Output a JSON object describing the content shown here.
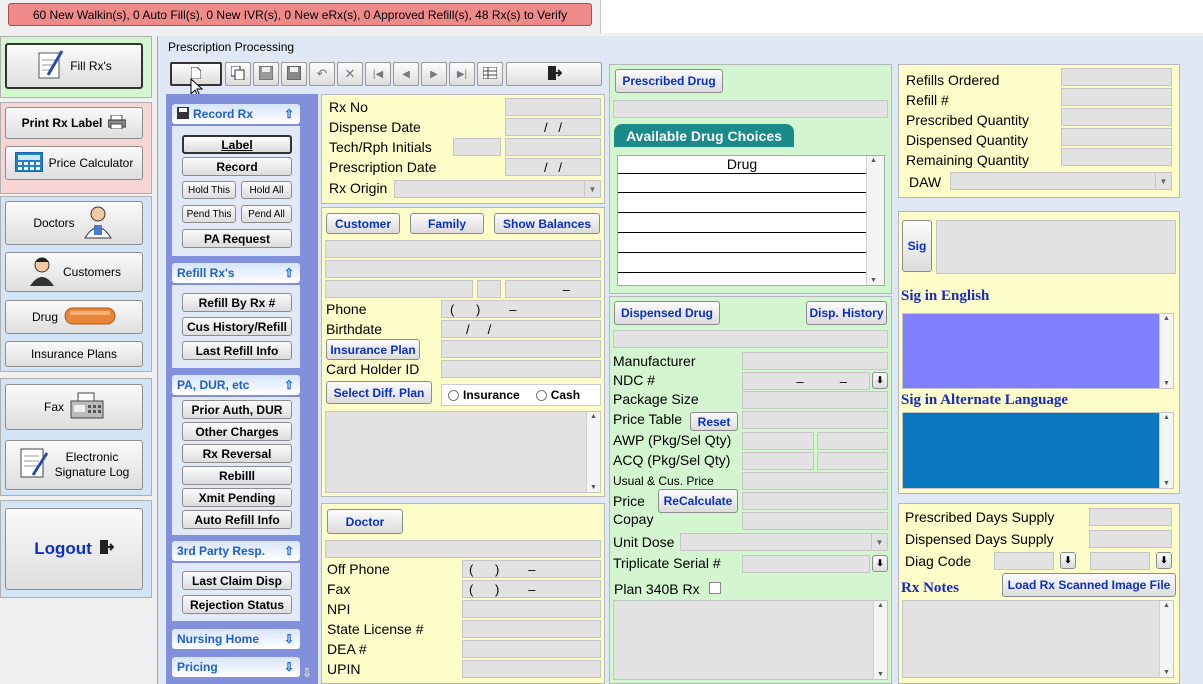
{
  "banner": "60 New Walkin(s), 0 Auto Fill(s), 0 New IVR(s), 0 New eRx(s), 0 Approved Refill(s), 48 Rx(s) to Verify",
  "window_title": "Prescription Processing",
  "nav": {
    "fill_rx": "Fill Rx's",
    "print_rx_label": "Print Rx Label",
    "price_calculator": "Price Calculator",
    "doctors": "Doctors",
    "customers": "Customers",
    "drug": "Drug",
    "insurance_plans": "Insurance Plans",
    "fax": "Fax",
    "esig_line1": "Electronic",
    "esig_line2": "Signature Log",
    "logout": "Logout"
  },
  "accordion": {
    "record_rx": {
      "title": "Record Rx",
      "label": "Label",
      "record": "Record",
      "hold_this": "Hold This",
      "hold_all": "Hold All",
      "pend_this": "Pend This",
      "pend_all": "Pend All",
      "pa_request": "PA Request"
    },
    "refill_rx": {
      "title": "Refill Rx's",
      "refill_by_rx": "Refill By Rx #",
      "cus_history": "Cus History/Refill",
      "last_refill_info": "Last Refill Info"
    },
    "pa_dur": {
      "title": "PA, DUR, etc",
      "prior_auth": "Prior Auth, DUR",
      "other_charges": "Other Charges",
      "rx_reversal": "Rx Reversal",
      "rebill": "Rebilll",
      "xmit_pending": "Xmit Pending",
      "auto_refill_info": "Auto Refill Info"
    },
    "third_party": {
      "title": "3rd Party Resp.",
      "last_claim_disp": "Last Claim Disp",
      "rejection_status": "Rejection Status"
    },
    "nursing_home": {
      "title": "Nursing Home"
    },
    "pricing": {
      "title": "Pricing"
    }
  },
  "rx": {
    "rx_no": "Rx No",
    "dispense_date": "Dispense Date",
    "tech_initials": "Tech/Rph Initials",
    "prescription_date": "Prescription Date",
    "rx_origin": "Rx Origin",
    "date_mask": "  /   /  "
  },
  "customer": {
    "customer_btn": "Customer",
    "family_btn": "Family",
    "show_balances_btn": "Show Balances",
    "zip_mask": "–",
    "phone": "Phone",
    "phone_mask": "(      )        –",
    "birthdate": "Birthdate",
    "birthdate_mask": "/     /",
    "insurance_plan_btn": "Insurance Plan",
    "card_holder_id": "Card Holder ID",
    "select_diff_plan_btn": "Select Diff. Plan",
    "insurance": "Insurance",
    "cash": "Cash"
  },
  "doctor": {
    "doctor_btn": "Doctor",
    "off_phone": "Off Phone",
    "fax": "Fax",
    "npi": "NPI",
    "state_license": "State License #",
    "dea": "DEA #",
    "upin": "UPIN",
    "phone_mask": "(      )        –"
  },
  "drug": {
    "prescribed_drug_btn": "Prescribed Drug",
    "available_drug_choices": "Available Drug Choices",
    "drug_col": "Drug",
    "dispensed_drug_btn": "Dispensed Drug",
    "disp_history_btn": "Disp. History",
    "manufacturer": "Manufacturer",
    "ndc": "NDC #",
    "ndc_mask": "–          –",
    "package_size": "Package Size",
    "price_table": "Price Table",
    "reset_btn": "Reset",
    "awp": "AWP (Pkg/Sel Qty)",
    "acq": "ACQ (Pkg/Sel Qty)",
    "usual_cus_price": "Usual & Cus. Price",
    "price": "Price",
    "recalculate_btn": "ReCalculate",
    "copay": "Copay",
    "unit_dose": "Unit Dose",
    "triplicate_serial": "Triplicate Serial #",
    "plan_340b": "Plan 340B Rx"
  },
  "refills": {
    "refills_ordered": "Refills Ordered",
    "refill_no": "Refill #",
    "prescribed_qty": "Prescribed Quantity",
    "dispensed_qty": "Dispensed Quantity",
    "remaining_qty": "Remaining Quantity",
    "daw": "DAW"
  },
  "sig": {
    "sig_btn": "Sig",
    "sig_in_english": "Sig in English",
    "sig_alt_language": "Sig in Alternate Language"
  },
  "supply": {
    "prescribed_days_supply": "Prescribed Days Supply",
    "dispensed_days_supply": "Dispensed Days Supply",
    "diag_code": "Diag Code",
    "rx_notes": "Rx Notes",
    "load_scanned_btn": "Load Rx Scanned Image File"
  },
  "colors": {
    "banner_bg": "#ee8a8a",
    "panel_yellow": "#fdfdc9",
    "panel_green": "#d3f5cf",
    "nav_purple": "#8290dc",
    "sig_english": "#8080ff",
    "sig_alt": "#0a78c0",
    "link_blue": "#0a2fc8",
    "teal_tab": "#1a8a8a"
  }
}
